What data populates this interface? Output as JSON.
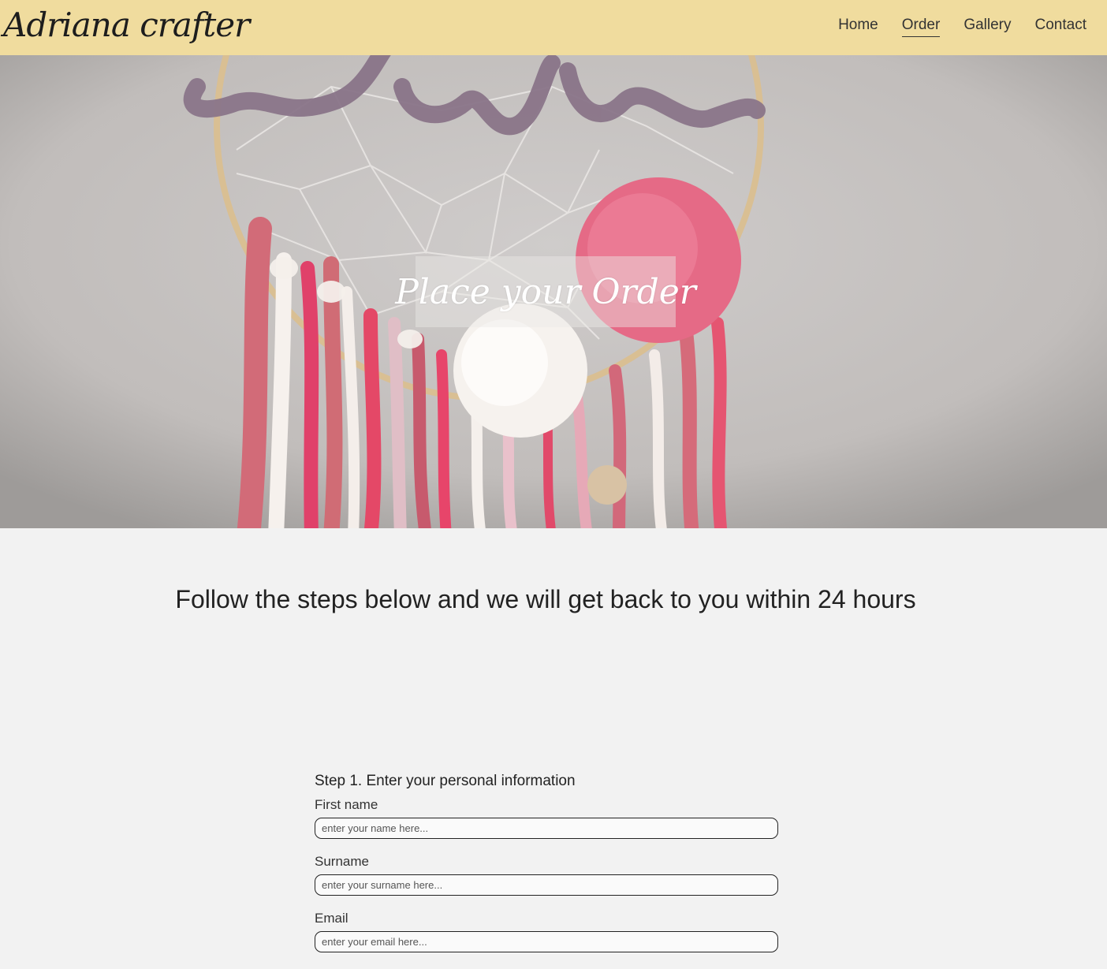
{
  "header": {
    "brand": "Adriana crafter",
    "nav": [
      {
        "label": "Home",
        "active": false
      },
      {
        "label": "Order",
        "active": true
      },
      {
        "label": "Gallery",
        "active": false
      },
      {
        "label": "Contact",
        "active": false
      }
    ],
    "background_color": "#f0dc9e"
  },
  "hero": {
    "title": "Place your Order"
  },
  "intro": {
    "text": "Follow the steps below and we will get back to you within 24 hours"
  },
  "form": {
    "step1_title": "Step 1. Enter your personal information",
    "fields": [
      {
        "label": "First name",
        "placeholder": "enter your name here..."
      },
      {
        "label": "Surname",
        "placeholder": "enter your surname here..."
      },
      {
        "label": "Email",
        "placeholder": "enter your email here..."
      }
    ]
  }
}
